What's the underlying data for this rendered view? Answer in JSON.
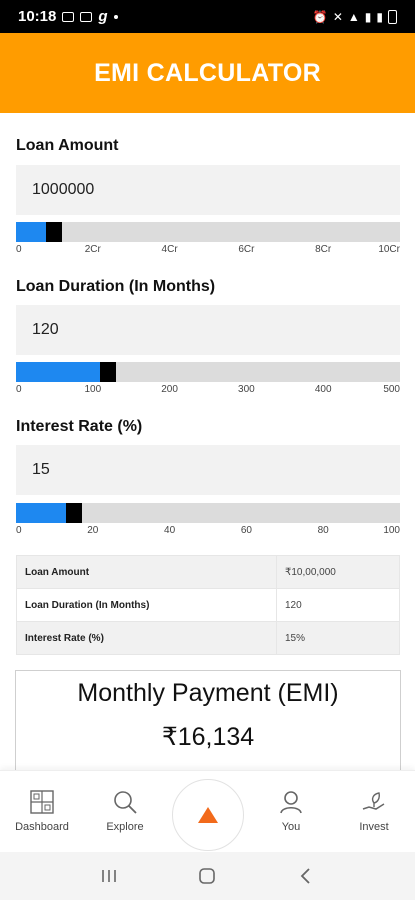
{
  "status_bar": {
    "time": "10:18",
    "battery": ""
  },
  "header": {
    "title": "EMI CALCULATOR"
  },
  "loan_amount": {
    "label": "Loan Amount",
    "value": "1000000",
    "slider_fraction": 0.1,
    "ticks": [
      "0",
      "2Cr",
      "4Cr",
      "6Cr",
      "8Cr",
      "10Cr"
    ]
  },
  "loan_duration": {
    "label": "Loan Duration (In Months)",
    "value": "120",
    "slider_fraction": 0.24,
    "ticks": [
      "0",
      "100",
      "200",
      "300",
      "400",
      "500"
    ]
  },
  "interest_rate": {
    "label": "Interest Rate (%)",
    "value": "15",
    "slider_fraction": 0.15,
    "ticks": [
      "0",
      "20",
      "40",
      "60",
      "80",
      "100"
    ]
  },
  "summary": [
    {
      "key": "Loan Amount",
      "value": "₹10,00,000"
    },
    {
      "key": "Loan Duration (In Months)",
      "value": "120"
    },
    {
      "key": "Interest Rate (%)",
      "value": "15%"
    }
  ],
  "emi": {
    "title": "Monthly Payment (EMI)",
    "value": "₹16,134"
  },
  "nav": {
    "dashboard": "Dashboard",
    "explore": "Explore",
    "you": "You",
    "invest": "Invest"
  },
  "colors": {
    "header": "#FF9C00",
    "accent": "#1E88F0",
    "thumb": "#000000",
    "center_icon": "#F26A1B"
  }
}
